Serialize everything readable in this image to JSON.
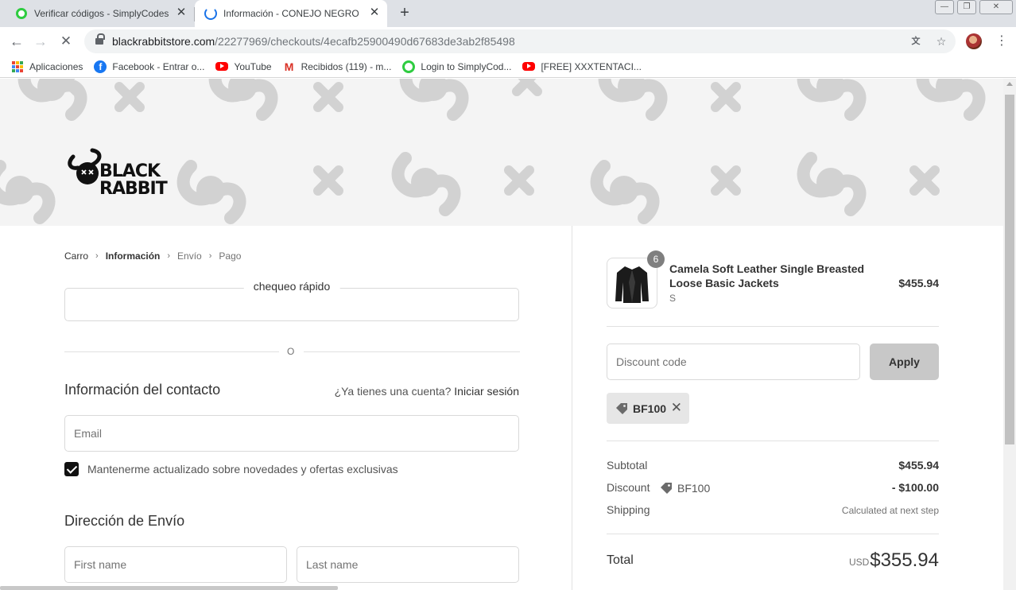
{
  "browser": {
    "tabs": [
      {
        "title": "Verificar códigos - SimplyCodes"
      },
      {
        "title": "Información - CONEJO NEGRO -"
      }
    ],
    "new_tab_symbol": "+",
    "url_host": "blackrabbitstore.com",
    "url_path": "/22277969/checkouts/4ecafb25900490d67683de3ab2f85498",
    "bookmarks": [
      {
        "label": "Aplicaciones",
        "icon": "apps-grid-icon"
      },
      {
        "label": "Facebook - Entrar o...",
        "icon": "facebook-icon"
      },
      {
        "label": "YouTube",
        "icon": "youtube-icon"
      },
      {
        "label": "Recibidos (119) - m...",
        "icon": "gmail-icon"
      },
      {
        "label": "Login to SimplyCod...",
        "icon": "simplycodes-icon"
      },
      {
        "label": "[FREE] XXXTENTACI...",
        "icon": "youtube-icon"
      }
    ]
  },
  "store": {
    "logo_line1": "BLACK",
    "logo_line2": "RABBIT"
  },
  "checkout": {
    "breadcrumb": [
      "Carro",
      "Información",
      "Envío",
      "Pago"
    ],
    "express_title": "chequeo rápido",
    "or_text": "O",
    "contact_title": "Información del contacto",
    "account_question": "¿Ya tienes una cuenta?",
    "login_link": "Iniciar sesión",
    "email_placeholder": "Email",
    "newsletter_label": "Mantenerme actualizado sobre novedades y ofertas exclusivas",
    "newsletter_checked": true,
    "shipping_title": "Dirección de Envío",
    "first_name_placeholder": "First name",
    "last_name_placeholder": "Last name"
  },
  "summary": {
    "product": {
      "quantity": "6",
      "name": "Camela Soft Leather Single Breasted Loose Basic Jackets",
      "variant": "S",
      "price": "$455.94"
    },
    "discount_placeholder": "Discount code",
    "apply_label": "Apply",
    "applied_code": "BF100",
    "subtotal_label": "Subtotal",
    "subtotal_value": "$455.94",
    "discount_label": "Discount",
    "discount_code": "BF100",
    "discount_value": "- $100.00",
    "shipping_label": "Shipping",
    "shipping_value": "Calculated at next step",
    "total_label": "Total",
    "total_currency": "USD",
    "total_value": "$355.94"
  },
  "colors": {
    "chrome_bg": "#dee1e6",
    "apply_bg": "#c8c8c8",
    "banner_bg": "#f4f4f4",
    "pattern": "#d2d2d2"
  }
}
